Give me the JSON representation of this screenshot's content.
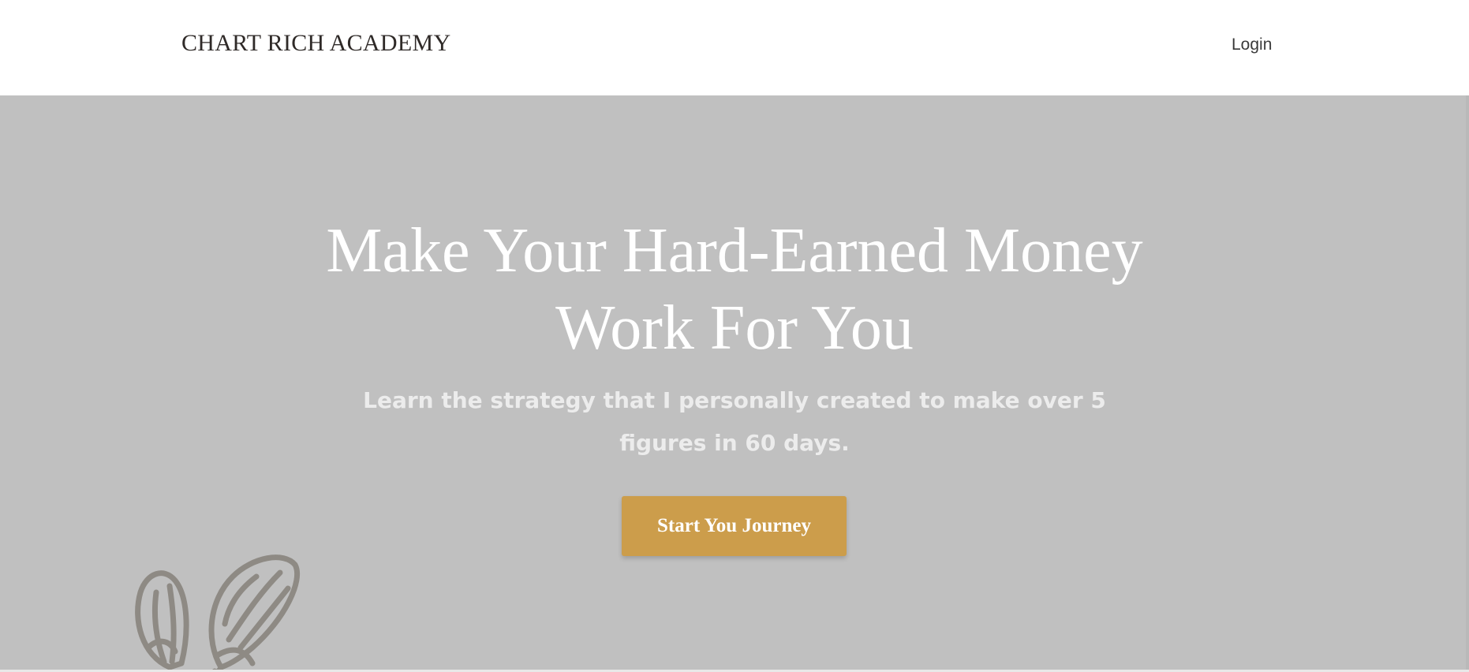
{
  "header": {
    "brand": "CHART RICH ACADEMY",
    "login_label": "Login"
  },
  "hero": {
    "headline": "Make Your Hard-Earned Money Work For You",
    "subheadline": "Learn the strategy that I personally created to make over 5 figures in 60 days.",
    "cta_label": "Start You Journey",
    "decoration_icon": "flower-sketch-icon"
  },
  "colors": {
    "header_bg": "#ffffff",
    "hero_bg": "#c0c0c0",
    "headline_text": "#ffffff",
    "subheadline_text": "#ececec",
    "cta_bg": "#cc9d4b",
    "cta_text": "#ffffff",
    "brand_text": "#2f2a28",
    "decoration": "#8e8a84"
  }
}
